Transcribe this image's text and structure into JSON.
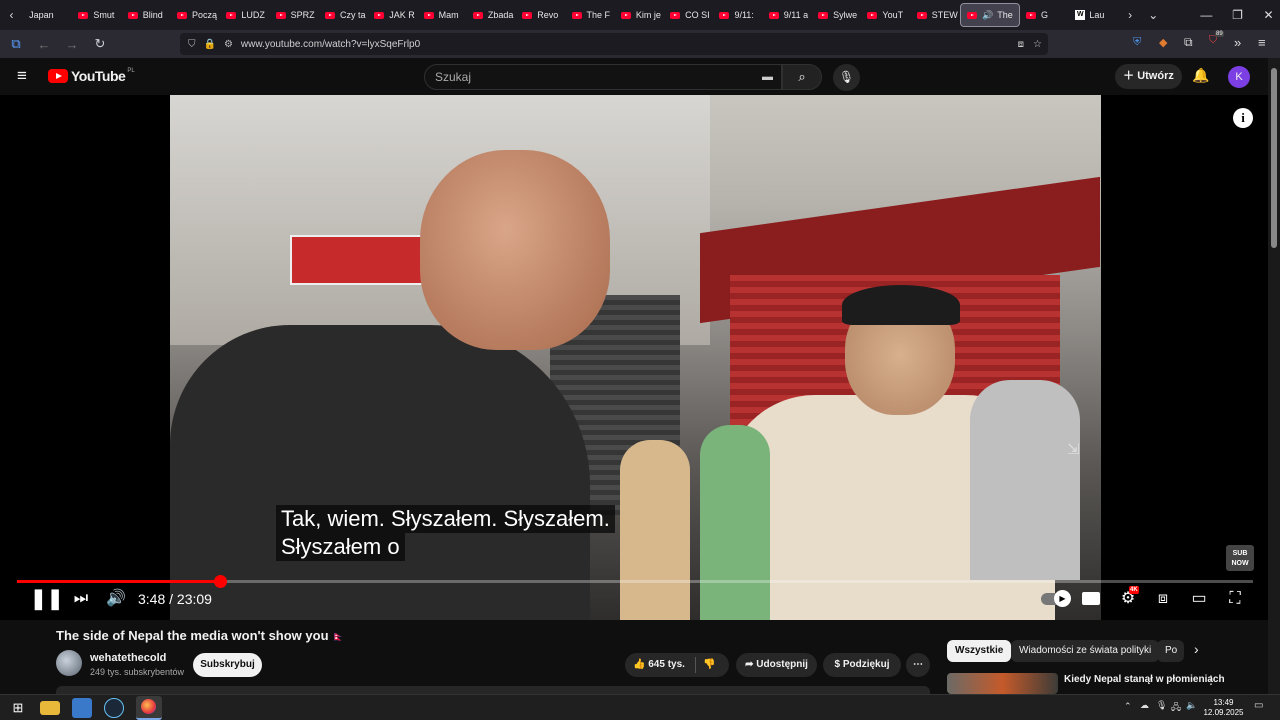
{
  "browser": {
    "tabs": [
      {
        "label": "Japan"
      },
      {
        "label": "Smut"
      },
      {
        "label": "Blind"
      },
      {
        "label": "Począ"
      },
      {
        "label": "LUDZ"
      },
      {
        "label": "SPRZ"
      },
      {
        "label": "Czy ta"
      },
      {
        "label": "JAK R"
      },
      {
        "label": "Mam"
      },
      {
        "label": "Zbada"
      },
      {
        "label": "Revo"
      },
      {
        "label": "The F"
      },
      {
        "label": "Kim je"
      },
      {
        "label": "CO SI"
      },
      {
        "label": "9/11:"
      },
      {
        "label": "9/11 a"
      },
      {
        "label": "Sylwe"
      },
      {
        "label": "YouT"
      },
      {
        "label": "STEW"
      }
    ],
    "active_tab": {
      "label": "The"
    },
    "extra_tabs": [
      {
        "label": "G"
      },
      {
        "label": "Lau"
      }
    ],
    "url": "www.youtube.com/watch?v=lyxSqeFrlp0",
    "badge_count": "89"
  },
  "youtube": {
    "logo_text": "YouTube",
    "region": "PL",
    "search_placeholder": "Szukaj",
    "create_label": "Utwórz",
    "avatar_letter": "K"
  },
  "player": {
    "subtitle_line1": "Tak, wiem.  Słyszałem.  Słyszałem.",
    "subtitle_line2": "Słyszałem o",
    "current_time": "3:48",
    "duration": "23:09",
    "progress_fraction": 0.164,
    "quality_badge": "4K",
    "watermark": "SUB NOW"
  },
  "video": {
    "title": "The side of Nepal the media won't show you",
    "flag": "🇳🇵",
    "channel": "wehatethecold",
    "subscribers": "249 tys. subskrybentów",
    "subscribe_label": "Subskrybuj",
    "likes": "645 tys.",
    "share_label": "Udostępnij",
    "thanks_label": "Podziękuj"
  },
  "sidebar": {
    "chips": [
      {
        "label": "Wszystkie"
      },
      {
        "label": "Wiadomości ze świata polityki"
      },
      {
        "label": "Po"
      }
    ],
    "rec_title": "Kiedy Nepal stanął w płomieniach"
  },
  "taskbar": {
    "time": "13:49",
    "date": "12.09.2025"
  }
}
